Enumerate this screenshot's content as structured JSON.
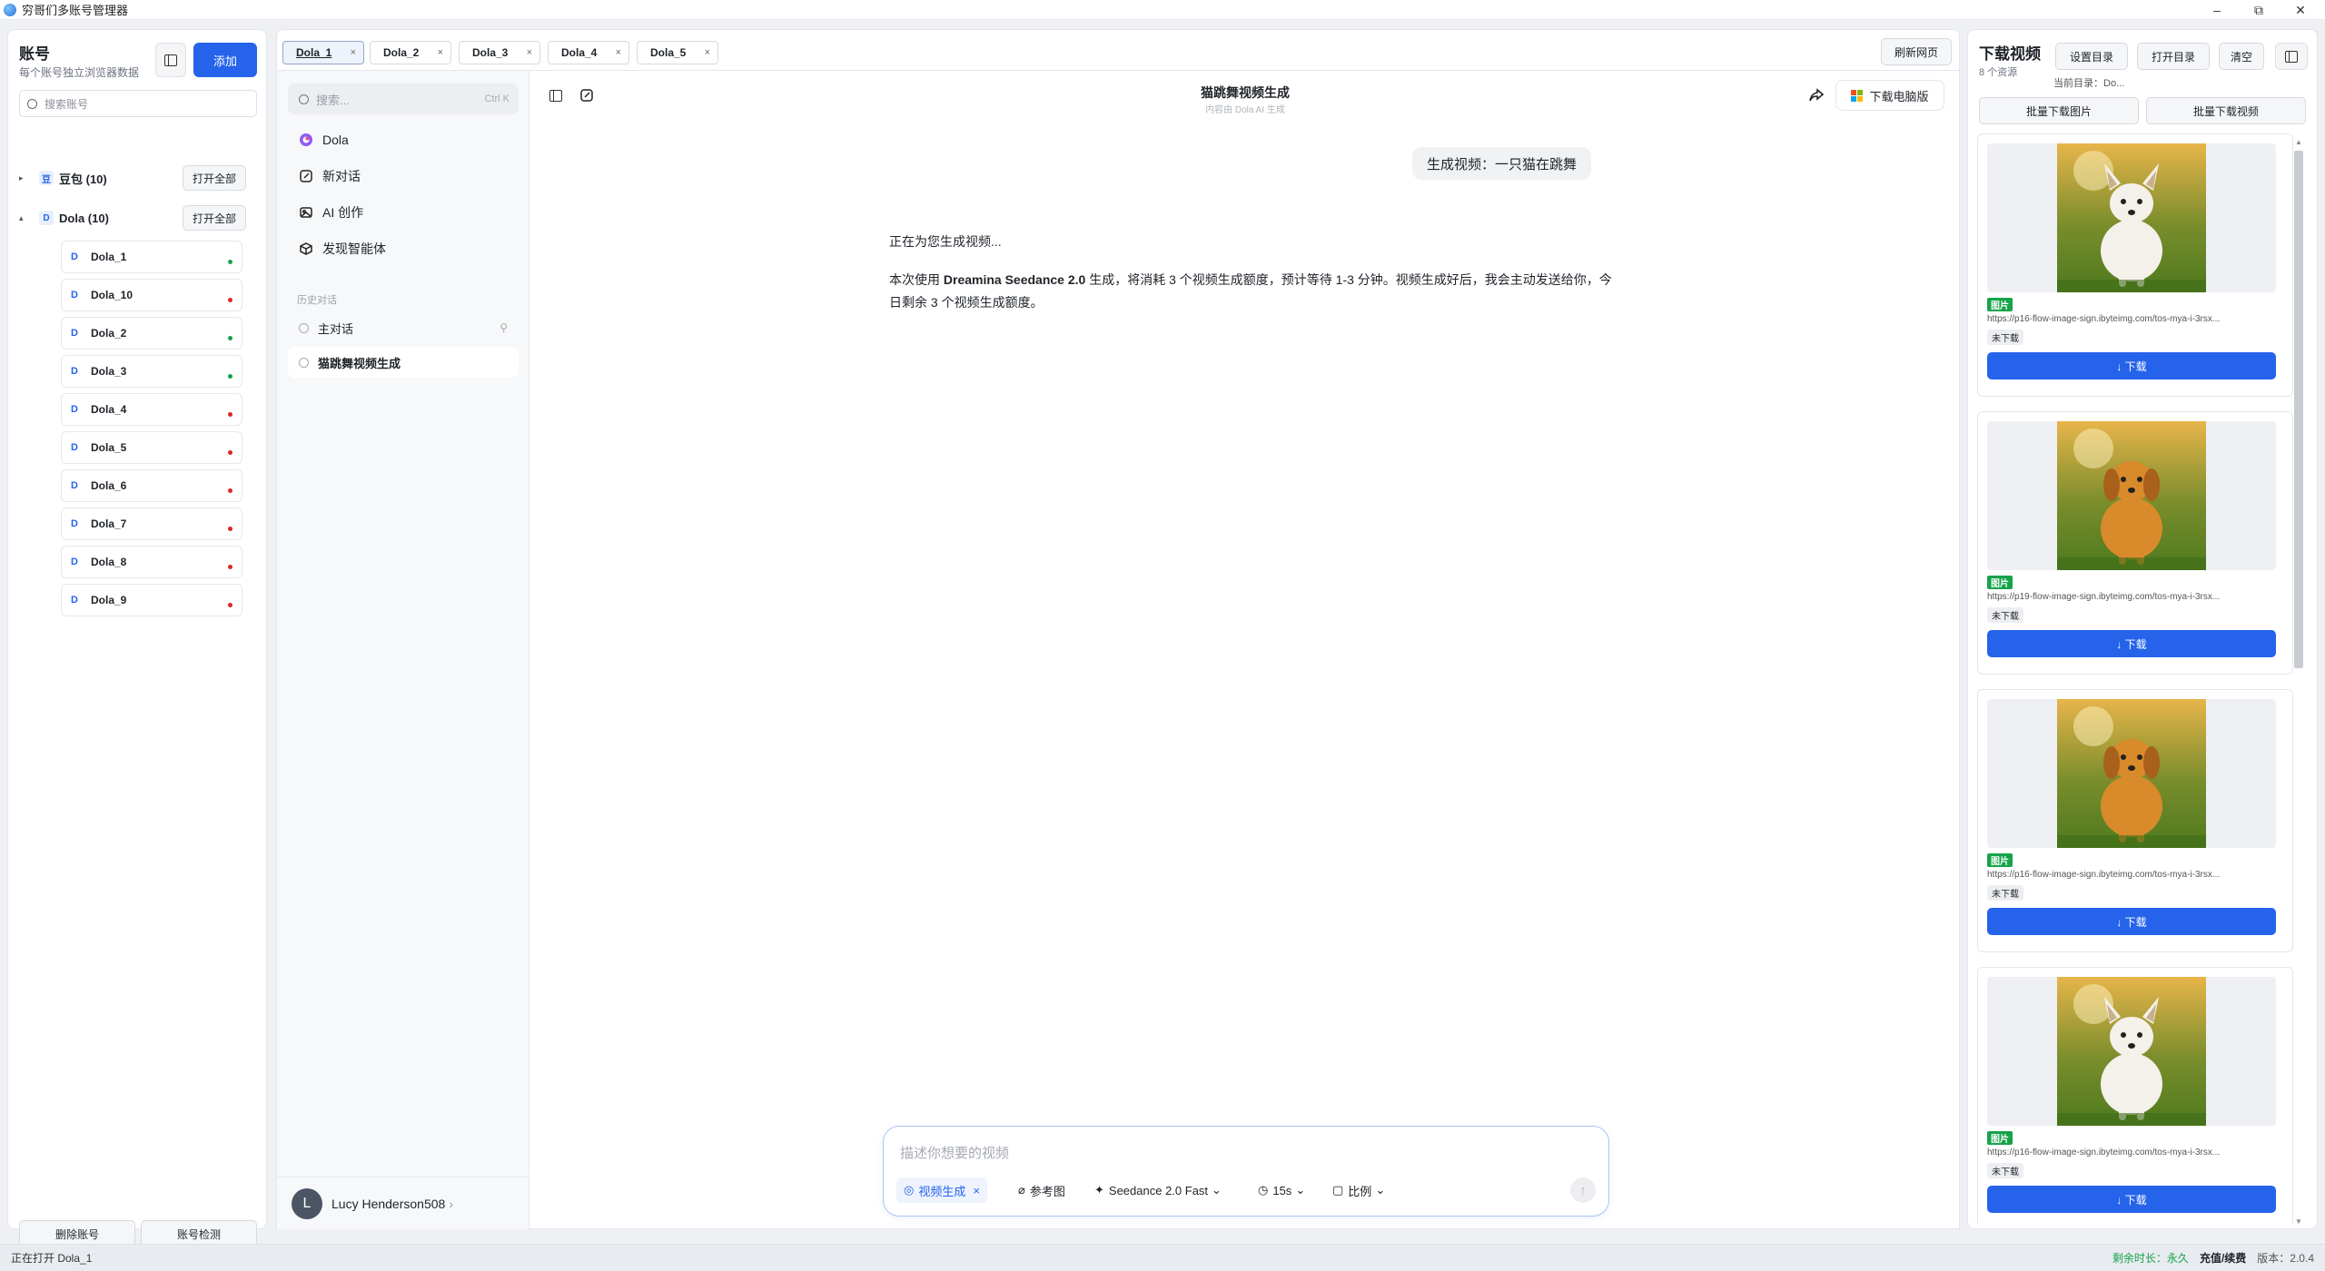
{
  "window": {
    "title": "穷哥们多账号管理器",
    "minimize": "–",
    "maximize": "⧉",
    "close": "✕"
  },
  "accounts_panel": {
    "title": "账号",
    "subtitle": "每个账号独立浏览器数据",
    "add_label": "添加",
    "search_placeholder": "搜索账号",
    "groups": [
      {
        "badge": "豆",
        "name": "豆包 (10)",
        "open_all": "打开全部",
        "expanded": false,
        "caret": "▸"
      },
      {
        "badge": "D",
        "name": "Dola (10)",
        "open_all": "打开全部",
        "expanded": true,
        "caret": "▴"
      }
    ],
    "items": [
      {
        "badge": "D",
        "name": "Dola_1",
        "status": "online"
      },
      {
        "badge": "D",
        "name": "Dola_10",
        "status": "offline"
      },
      {
        "badge": "D",
        "name": "Dola_2",
        "status": "online"
      },
      {
        "badge": "D",
        "name": "Dola_3",
        "status": "online"
      },
      {
        "badge": "D",
        "name": "Dola_4",
        "status": "offline"
      },
      {
        "badge": "D",
        "name": "Dola_5",
        "status": "offline"
      },
      {
        "badge": "D",
        "name": "Dola_6",
        "status": "offline"
      },
      {
        "badge": "D",
        "name": "Dola_7",
        "status": "offline"
      },
      {
        "badge": "D",
        "name": "Dola_8",
        "status": "offline"
      },
      {
        "badge": "D",
        "name": "Dola_9",
        "status": "offline"
      }
    ],
    "delete_label": "删除账号",
    "check_label": "账号检测"
  },
  "tabs": [
    {
      "label": "Dola_1",
      "active": true
    },
    {
      "label": "Dola_2",
      "active": false
    },
    {
      "label": "Dola_3",
      "active": false
    },
    {
      "label": "Dola_4",
      "active": false
    },
    {
      "label": "Dola_5",
      "active": false
    }
  ],
  "tab_close": "×",
  "refresh_label": "刷新网页",
  "dola": {
    "search_placeholder": "搜索...",
    "search_shortcut": "Ctrl K",
    "nav": [
      {
        "label": "Dola",
        "icon": "dola-logo-icon"
      },
      {
        "label": "新对话",
        "icon": "edit-icon"
      },
      {
        "label": "AI 创作",
        "icon": "image-icon"
      },
      {
        "label": "发现智能体",
        "icon": "cube-icon"
      }
    ],
    "history_label": "历史对话",
    "history": [
      {
        "label": "主对话",
        "selected": false
      },
      {
        "label": "猫跳舞视频生成",
        "selected": true
      }
    ],
    "user_initial": "L",
    "user_name": "Lucy Henderson508",
    "user_chevron": "›",
    "chat_title": "猫跳舞视频生成",
    "chat_subtitle": "内容由 Dola AI 生成",
    "download_pc": "下载电脑版",
    "user_message": "生成视频：一只猫在跳舞",
    "bot_line1": "正在为您生成视频...",
    "bot_line2_pre": "本次使用 ",
    "bot_line2_bold": "Dreamina Seedance 2.0",
    "bot_line2_post": " 生成，将消耗 3 个视频生成额度，预计等待 1-3 分钟。视频生成好后，我会主动发送给你，今日剩余 3 个视频生成额度。",
    "composer_placeholder": "描述你想要的视频",
    "chip_video": "视频生成",
    "chip_video_close": "×",
    "chip_ref": "参考图",
    "chip_model": "Seedance 2.0 Fast",
    "chip_duration": "15s",
    "chip_ratio": "比例",
    "chip_dropdown": "⌄",
    "send_arrow": "↑"
  },
  "downloads": {
    "title": "下载视频",
    "count": "8 个资源",
    "set_dir": "设置目录",
    "open_dir": "打开目录",
    "clear": "清空",
    "current_dir": "当前目录：Do...",
    "batch_images": "批量下载图片",
    "batch_videos": "批量下载视频",
    "items": [
      {
        "tag": "图片",
        "url": "https://p16-flow-image-sign.ibyteimg.com/tos-mya-i-3rsx...",
        "status": "未下载",
        "button": "↓ 下载",
        "subject": "white-dog"
      },
      {
        "tag": "图片",
        "url": "https://p19-flow-image-sign.ibyteimg.com/tos-mya-i-3rsx...",
        "status": "未下载",
        "button": "↓ 下载",
        "subject": "golden-dog"
      },
      {
        "tag": "图片",
        "url": "https://p16-flow-image-sign.ibyteimg.com/tos-mya-i-3rsx...",
        "status": "未下载",
        "button": "↓ 下载",
        "subject": "golden-dog"
      },
      {
        "tag": "图片",
        "url": "https://p16-flow-image-sign.ibyteimg.com/tos-mya-i-3rsx...",
        "status": "未下载",
        "button": "↓ 下载",
        "subject": "white-dog"
      }
    ]
  },
  "statusbar": {
    "left": "正在打开 Dola_1",
    "remaining_label": "剩余时长：",
    "remaining_value": "永久",
    "renew": "充值/续费",
    "version_label": "版本：",
    "version_value": "2.0.4"
  },
  "colors": {
    "accent": "#2563eb",
    "online": "#16a34a",
    "offline": "#dc2626",
    "tag": "#16a34a"
  }
}
